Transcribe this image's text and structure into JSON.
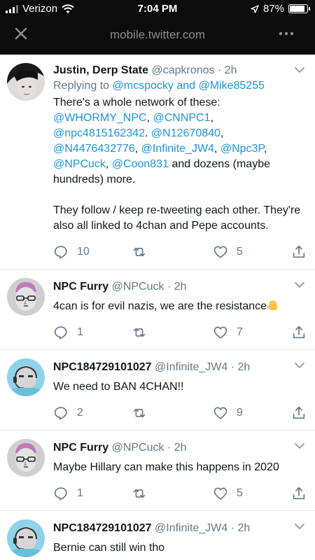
{
  "status_bar": {
    "carrier": "Verizon",
    "time": "7:04 PM",
    "battery": "87%",
    "battery_level": 0.87
  },
  "browser": {
    "url": "mobile.twitter.com",
    "close_icon": "close-icon",
    "more_icon": "more-icon"
  },
  "tweets": [
    {
      "name": "Justin, Derp State",
      "handle": "@capkronos",
      "time": "2h",
      "reply_prefix": "Replying to",
      "reply_user1": "@mcspocky",
      "reply_and": "and",
      "reply_user2": "@Mike85255",
      "p1_intro": "There's a whole network of these:",
      "m1": "@WHORMY_NPC",
      "m2": "@CNNPC1",
      "m3": "@npc4815162342",
      "m4": "@N12670840",
      "m5": "@N4476432776",
      "m6": "@Infinite_JW4",
      "m7": "@Npc3P",
      "m8": "@NPCuck",
      "m9": "@Coon831",
      "p1_outro": "and dozens (maybe hundreds) more.",
      "p2": "They follow / keep re-tweeting each other. They're also all linked to 4chan and Pepe accounts.",
      "replies": "10",
      "retweets": "",
      "likes": "5"
    },
    {
      "name": "NPC Furry",
      "handle": "@NPCuck",
      "time": "2h",
      "text": "4can is for evil nazis, we are the resistance",
      "emoji": "raised-fist-emoji",
      "replies": "1",
      "retweets": "",
      "likes": "7"
    },
    {
      "name": "NPC184729101027",
      "handle": "@Infinite_JW4",
      "time": "2h",
      "text": "We need to BAN 4CHAN!!",
      "replies": "2",
      "retweets": "",
      "likes": "9"
    },
    {
      "name": "NPC Furry",
      "handle": "@NPCuck",
      "time": "2h",
      "text": "Maybe Hillary can make this happens in 2020",
      "replies": "1",
      "retweets": "",
      "likes": "5"
    },
    {
      "name": "NPC184729101027",
      "handle": "@Infinite_JW4",
      "time": "2h",
      "text": "Bernie can still win tho"
    }
  ],
  "colors": {
    "link": "#1b95e0",
    "muted": "#657786",
    "chrome": "#0c0c0c"
  }
}
